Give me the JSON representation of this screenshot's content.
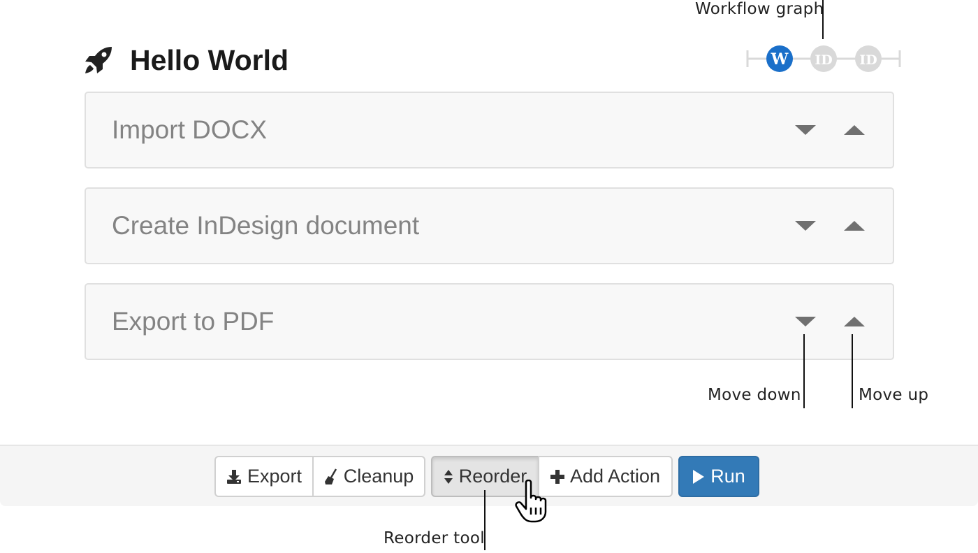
{
  "annotations": {
    "workflow_graph": "Workflow graph",
    "move_down": "Move down",
    "move_up": "Move up",
    "reorder_tool": "Reorder tool"
  },
  "header": {
    "title": "Hello World",
    "icon": "rocket-icon"
  },
  "workflow_graph": {
    "nodes": [
      {
        "label": "W",
        "active": true,
        "color": "#1a6fc9"
      },
      {
        "label": "ID",
        "active": false,
        "color": "#d9d9d9"
      },
      {
        "label": "ID",
        "active": false,
        "color": "#d9d9d9"
      }
    ]
  },
  "actions": [
    {
      "label": "Import DOCX"
    },
    {
      "label": "Create InDesign document"
    },
    {
      "label": "Export to PDF"
    }
  ],
  "toolbar": {
    "export_label": "Export",
    "cleanup_label": "Cleanup",
    "reorder_label": "Reorder",
    "reorder_active": true,
    "add_action_label": "Add Action",
    "run_label": "Run"
  },
  "colors": {
    "primary": "#337ab7",
    "graph_active": "#1a6fc9",
    "graph_inactive": "#d9d9d9",
    "action_text": "#838383"
  }
}
